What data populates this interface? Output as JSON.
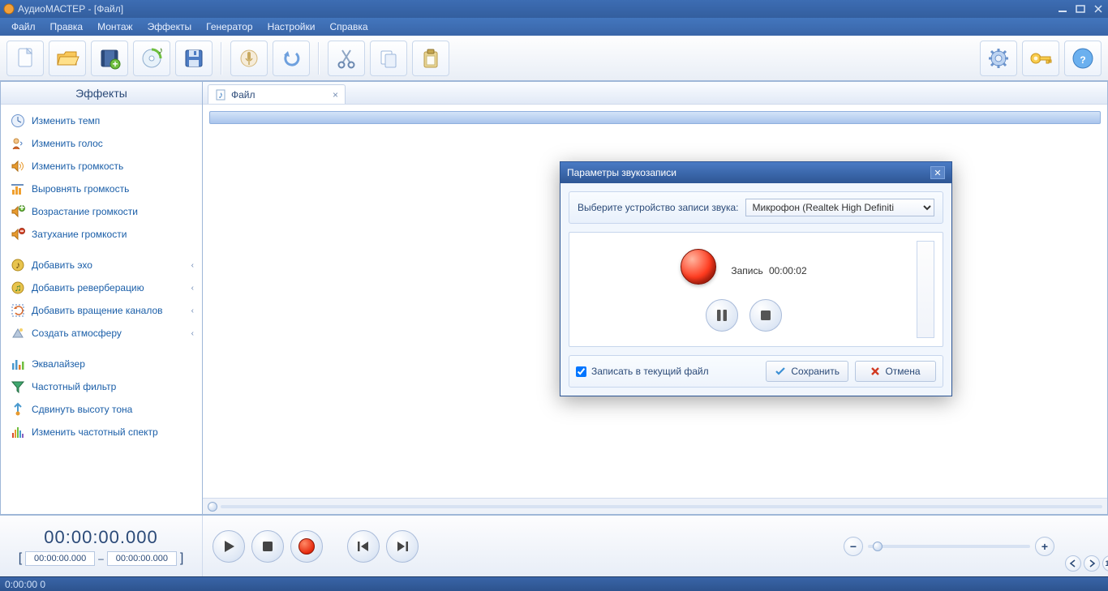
{
  "title": "АудиоМАСТЕР - [Файл]",
  "menu": [
    "Файл",
    "Правка",
    "Монтаж",
    "Эффекты",
    "Генератор",
    "Настройки",
    "Справка"
  ],
  "toolbar": {
    "icons": [
      "new",
      "open",
      "video",
      "cd",
      "save",
      "mic",
      "undo",
      "cut",
      "copy",
      "paste",
      "settings",
      "key",
      "help"
    ]
  },
  "sidebar": {
    "title": "Эффекты",
    "groups": [
      [
        {
          "icon": "clock",
          "label": "Изменить темп",
          "chev": false
        },
        {
          "icon": "voice",
          "label": "Изменить голос",
          "chev": false
        },
        {
          "icon": "volume",
          "label": "Изменить громкость",
          "chev": false
        },
        {
          "icon": "normalize",
          "label": "Выровнять громкость",
          "chev": false
        },
        {
          "icon": "fadein",
          "label": "Возрастание громкости",
          "chev": false
        },
        {
          "icon": "fadeout",
          "label": "Затухание громкости",
          "chev": false
        }
      ],
      [
        {
          "icon": "echo",
          "label": "Добавить эхо",
          "chev": true
        },
        {
          "icon": "reverb",
          "label": "Добавить реверберацию",
          "chev": true
        },
        {
          "icon": "rotate",
          "label": "Добавить вращение каналов",
          "chev": true
        },
        {
          "icon": "atmos",
          "label": "Создать атмосферу",
          "chev": true
        }
      ],
      [
        {
          "icon": "eq",
          "label": "Эквалайзер",
          "chev": false
        },
        {
          "icon": "filter",
          "label": "Частотный фильтр",
          "chev": false
        },
        {
          "icon": "pitch",
          "label": "Сдвинуть высоту тона",
          "chev": false
        },
        {
          "icon": "spectrum",
          "label": "Изменить частотный спектр",
          "chev": false
        }
      ]
    ]
  },
  "tab": {
    "label": "Файл"
  },
  "time": {
    "big": "00:00:00.000",
    "from": "00:00:00.000",
    "to": "00:00:00.000"
  },
  "dialog": {
    "title": "Параметры звукозаписи",
    "device_label": "Выберите устройство записи звука:",
    "device_value": "Микрофон (Realtek High Definiti",
    "rec_label": "Запись",
    "rec_time": "00:00:02",
    "checkbox": "Записать в текущий файл",
    "save": "Сохранить",
    "cancel": "Отмена"
  },
  "status": "0:00:00 0"
}
